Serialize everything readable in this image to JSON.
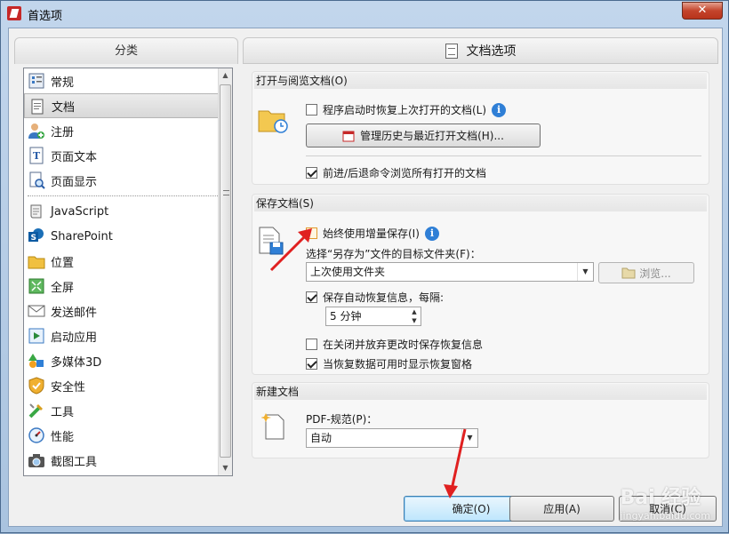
{
  "window": {
    "title": "首选项",
    "close_label": "✕"
  },
  "left": {
    "header": "分类",
    "items": [
      {
        "label": "常规",
        "selected": false
      },
      {
        "label": "文档",
        "selected": true
      },
      {
        "label": "注册",
        "selected": false
      },
      {
        "label": "页面文本",
        "selected": false
      },
      {
        "label": "页面显示",
        "selected": false
      },
      {
        "label": "JavaScript",
        "selected": false
      },
      {
        "label": "SharePoint",
        "selected": false
      },
      {
        "label": "位置",
        "selected": false
      },
      {
        "label": "全屏",
        "selected": false
      },
      {
        "label": "发送邮件",
        "selected": false
      },
      {
        "label": "启动应用",
        "selected": false
      },
      {
        "label": "多媒体3D",
        "selected": false
      },
      {
        "label": "安全性",
        "selected": false
      },
      {
        "label": "工具",
        "selected": false
      },
      {
        "label": "性能",
        "selected": false
      },
      {
        "label": "截图工具",
        "selected": false
      }
    ]
  },
  "right": {
    "header": "文档选项",
    "open_section": {
      "title": "打开与阅览文档(O)",
      "restore_label": "程序启动时恢复上次打开的文档(L)",
      "restore_checked": false,
      "manage_button": "管理历史与最近打开文档(H)...",
      "navigate_label": "前进/后退命令浏览所有打开的文档",
      "navigate_checked": true
    },
    "save_section": {
      "title": "保存文档(S)",
      "incremental_label": "始终使用增量保存(I)",
      "incremental_checked": false,
      "target_label": "选择“另存为”文件的目标文件夹(F)：",
      "target_value": "上次使用文件夹",
      "browse_button": "浏览...",
      "autosave_label": "保存自动恢复信息，每隔:",
      "autosave_checked": true,
      "interval_value": "5 分钟",
      "discard_label": "在关闭并放弃更改时保存恢复信息",
      "discard_checked": false,
      "show_pane_label": "当恢复数据可用时显示恢复窗格",
      "show_pane_checked": true
    },
    "new_section": {
      "title": "新建文档",
      "pdf_label": "PDF-规范(P)：",
      "pdf_value": "自动"
    }
  },
  "buttons": {
    "ok": "确定(O)",
    "apply": "应用(A)",
    "cancel": "取消(C)"
  },
  "watermark": {
    "brand": "Bai 经验",
    "url": "jingyan.baidu.com"
  },
  "colors": {
    "accent_blue": "#2f7fd6",
    "arrow_red": "#e02020",
    "close_red": "#c4442c"
  }
}
